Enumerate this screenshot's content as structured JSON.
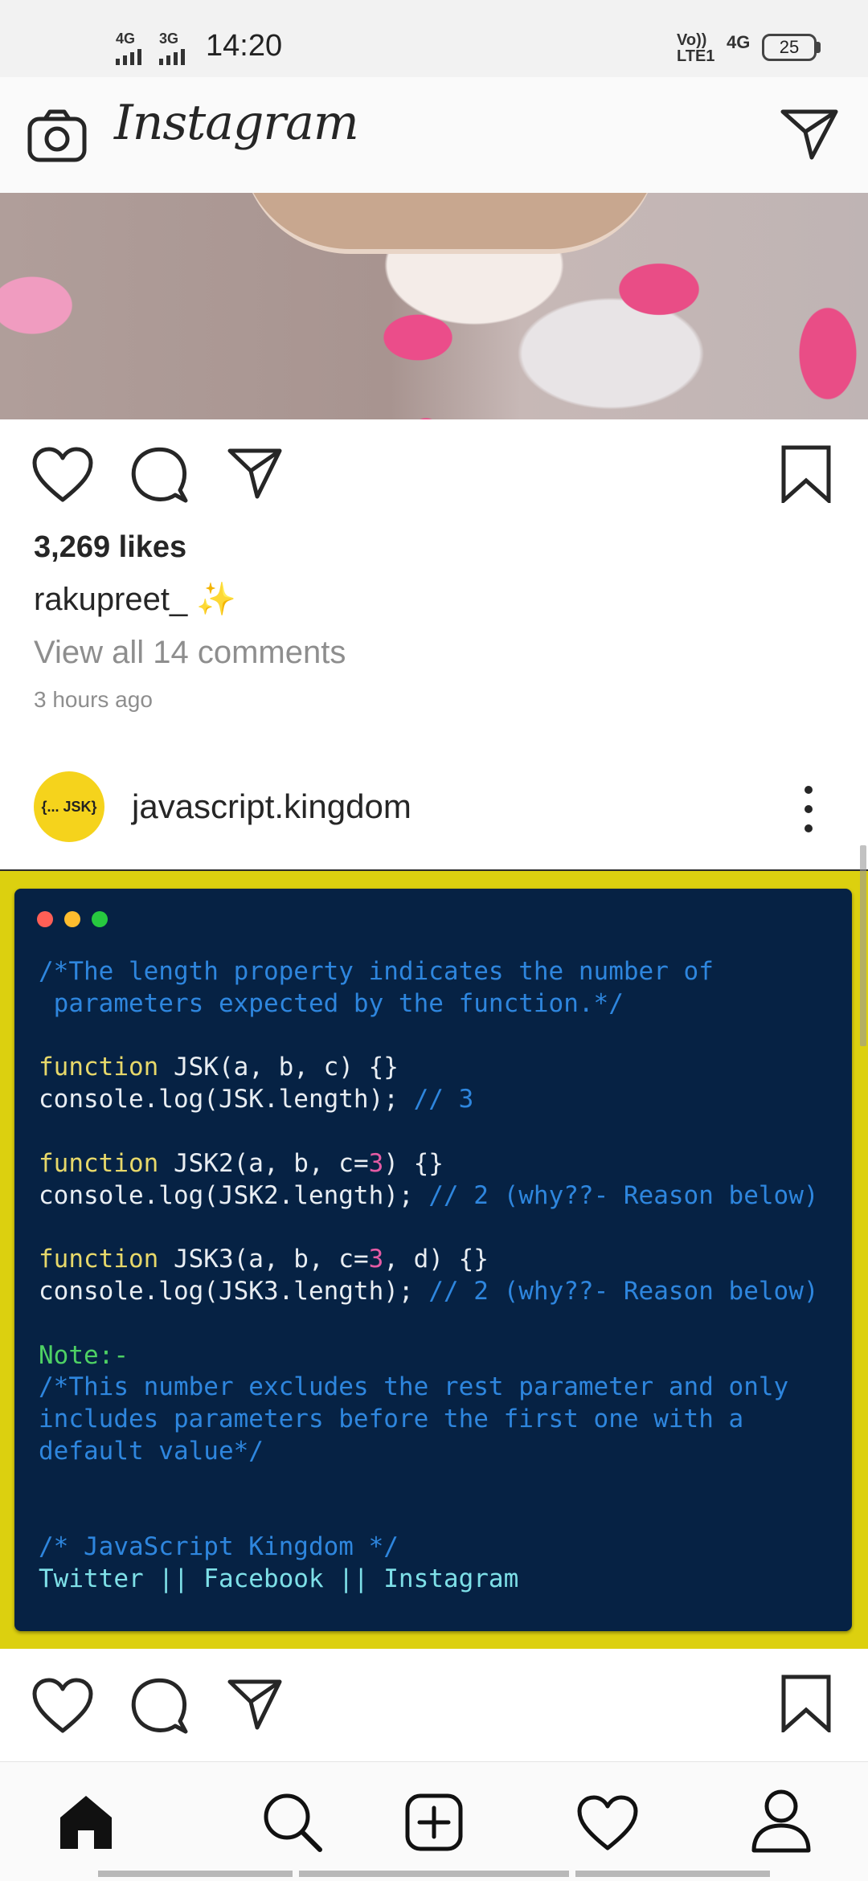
{
  "status_bar": {
    "time": "14:20",
    "network1": "4G",
    "network2": "3G",
    "volte": "Vo)) LTE1",
    "network3": "4G",
    "battery": "25"
  },
  "header": {
    "title": "Instagram",
    "icons": [
      "camera-icon",
      "direct-message-icon"
    ]
  },
  "post1": {
    "likes": "3,269 likes",
    "caption_user": "rakupreet_",
    "caption_emoji": "✨",
    "comments_link": "View all 14 comments",
    "time_ago": "3 hours ago"
  },
  "post2": {
    "avatar_text": "{... JSK}",
    "username": "javascript.kingdom",
    "code": {
      "l1": "/*The length property indicates the number of",
      "l2": " parameters expected by the function.*/",
      "l3_kw": "function",
      "l3_rest": " JSK(a, b, c) {}",
      "l4_code": "console.log(JSK.length); ",
      "l4_com": "// 3",
      "l5_kw": "function",
      "l5_a": " JSK2(a, b, c=",
      "l5_num": "3",
      "l5_b": ") {}",
      "l6_code": "console.log(JSK2.length); ",
      "l6_com": "// 2 (why??- Reason below)",
      "l7_kw": "function",
      "l7_a": " JSK3(a, b, c=",
      "l7_num": "3",
      "l7_b": ", d) {}",
      "l8_code": "console.log(JSK3.length); ",
      "l8_com": "// 2 (why??- Reason below)",
      "note": "Note:-",
      "n1": "/*This number excludes the rest parameter and only",
      "n2": "includes parameters before the first one with a",
      "n3": "default value*/",
      "brand": "/* JavaScript Kingdom */",
      "social": "Twitter || Facebook || Instagram"
    }
  },
  "bottom_nav": [
    "home-icon",
    "search-icon",
    "new-post-icon",
    "activity-heart-icon",
    "profile-icon"
  ],
  "colors": {
    "code_bg": "#062244",
    "frame_yellow": "#dcd00f",
    "avatar_yellow": "#f5d31c"
  }
}
